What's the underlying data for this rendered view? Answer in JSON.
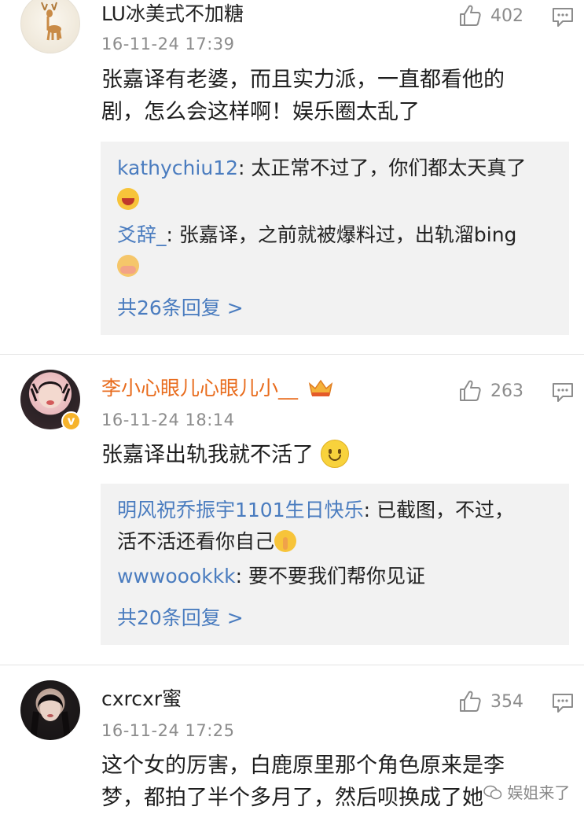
{
  "comments": [
    {
      "user": "LU冰美式不加糖",
      "time": "16-11-24 17:39",
      "likes": "402",
      "text_lines": [
        "张嘉译有老婆，而且实力派，一直都看他的",
        "剧，怎么会这样啊！娱乐圈太乱了"
      ],
      "replies": [
        {
          "user": "kathychiu12",
          "text": ": 太正常不过了，你们都太天真了",
          "emoji": "laughing-emoji"
        },
        {
          "user": "爻辞_",
          "text": ": 张嘉译，之前就被爆料过，出轨溜bing",
          "emoji": "shy-emoji"
        }
      ],
      "more_replies": "共26条回复 >"
    },
    {
      "user": "李小心眼儿心眼儿小__",
      "time": "16-11-24 18:14",
      "likes": "263",
      "text": "张嘉译出轨我就不活了",
      "replies": [
        {
          "user": "明风祝乔振宇1101生日快乐",
          "text": ": 已截图，不过，",
          "text2": "活不活还看你自己",
          "emoji": "shush-emoji"
        },
        {
          "user": "wwwoookkk",
          "text": ": 要不要我们帮你见证"
        }
      ],
      "more_replies": "共20条回复 >"
    },
    {
      "user": "cxrcxr蜜",
      "time": "16-11-24 17:25",
      "likes": "354",
      "text_lines": [
        "这个女的厉害，白鹿原里那个角色原来是李",
        "梦，都拍了半个多月了，然后呗换成了她"
      ]
    }
  ],
  "watermark": "娱姐来了",
  "colors": {
    "link": "#4a7cbf",
    "orange_name": "#e86b1c",
    "reply_bg": "#f2f2f2",
    "meta": "#8c8c8c"
  }
}
